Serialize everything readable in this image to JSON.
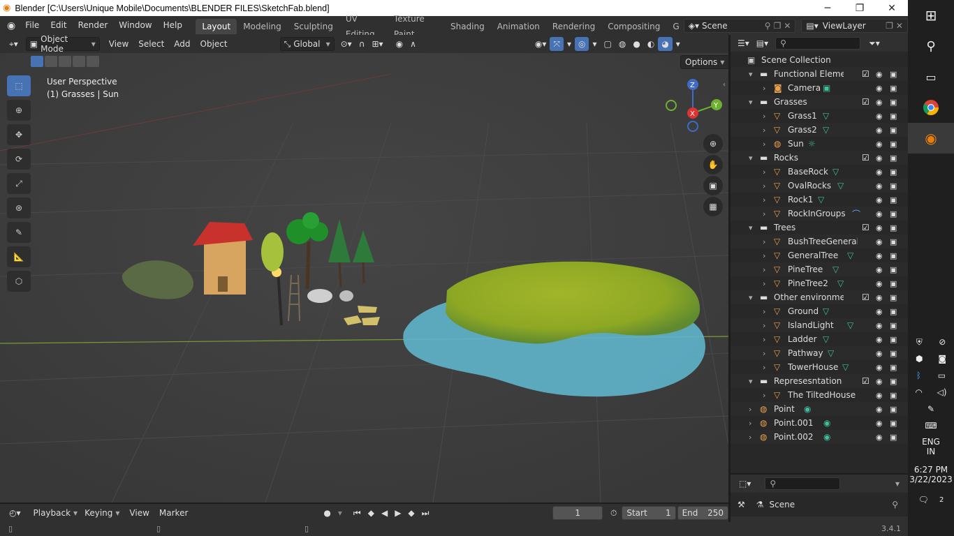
{
  "window": {
    "title": "Blender [C:\\Users\\Unique Mobile\\Documents\\BLENDER FILES\\SketchFab.blend]",
    "minimize": "─",
    "maximize": "❐",
    "close": "✕"
  },
  "menu": [
    "File",
    "Edit",
    "Render",
    "Window",
    "Help"
  ],
  "workspaces": [
    "Layout",
    "Modeling",
    "Sculpting",
    "UV Editing",
    "Texture Paint",
    "Shading",
    "Animation",
    "Rendering",
    "Compositing",
    "G"
  ],
  "scene_field": "Scene",
  "viewlayer_field": "ViewLayer",
  "viewport_header": {
    "mode": "Object Mode",
    "view": "View",
    "select": "Select",
    "add": "Add",
    "object": "Object",
    "orientation": "Global",
    "options": "Options"
  },
  "viewport": {
    "perspective": "User Perspective",
    "context": "(1) Grasses | Sun",
    "gizmo_x": "X",
    "gizmo_y": "Y",
    "gizmo_z": "Z"
  },
  "outliner": {
    "root": "Scene Collection",
    "rows": [
      {
        "name": "Functional Elements",
        "type": "collection",
        "level": 1,
        "check": true
      },
      {
        "name": "Camera",
        "type": "camera",
        "level": 2
      },
      {
        "name": "Grasses",
        "type": "collection",
        "level": 1,
        "check": true
      },
      {
        "name": "Grass1",
        "type": "mesh",
        "level": 2
      },
      {
        "name": "Grass2",
        "type": "mesh",
        "level": 2
      },
      {
        "name": "Sun",
        "type": "light",
        "level": 2
      },
      {
        "name": "Rocks",
        "type": "collection",
        "level": 1,
        "check": true
      },
      {
        "name": "BaseRock",
        "type": "mesh",
        "level": 2
      },
      {
        "name": "OvalRocks",
        "type": "mesh",
        "level": 2
      },
      {
        "name": "Rock1",
        "type": "mesh",
        "level": 2
      },
      {
        "name": "RockInGroups",
        "type": "curve",
        "level": 2
      },
      {
        "name": "Trees",
        "type": "collection",
        "level": 1,
        "check": true
      },
      {
        "name": "BushTreeGeneral",
        "type": "mesh-plain",
        "level": 2
      },
      {
        "name": "GeneralTree",
        "type": "mesh",
        "level": 2
      },
      {
        "name": "PineTree",
        "type": "mesh",
        "level": 2
      },
      {
        "name": "PineTree2",
        "type": "mesh",
        "level": 2
      },
      {
        "name": "Other environment",
        "type": "collection",
        "level": 1,
        "check": true
      },
      {
        "name": "Ground",
        "type": "mesh",
        "level": 2
      },
      {
        "name": "IslandLight",
        "type": "mesh",
        "level": 2
      },
      {
        "name": "Ladder",
        "type": "mesh",
        "level": 2
      },
      {
        "name": "Pathway",
        "type": "mesh",
        "level": 2
      },
      {
        "name": "TowerHouse",
        "type": "mesh",
        "level": 2
      },
      {
        "name": "Represesntation Scene",
        "type": "collection",
        "level": 1,
        "check": true
      },
      {
        "name": "The TiltedHouse isla",
        "type": "mesh-plain",
        "level": 2
      },
      {
        "name": "Point",
        "type": "point",
        "level": 1
      },
      {
        "name": "Point.001",
        "type": "point",
        "level": 1
      },
      {
        "name": "Point.002",
        "type": "point",
        "level": 1
      }
    ]
  },
  "properties": {
    "scene": "Scene"
  },
  "timeline": {
    "playback": "Playback",
    "keying": "Keying",
    "view": "View",
    "marker": "Marker",
    "current_frame": "1",
    "start_label": "Start",
    "start": "1",
    "end_label": "End",
    "end": "250"
  },
  "status": {
    "version": "3.4.1"
  },
  "taskbar": {
    "lang1": "ENG",
    "lang2": "IN",
    "time": "6:27 PM",
    "date": "3/22/2023",
    "notifications": "2"
  },
  "colors": {
    "accent": "#4772b3",
    "header": "#303030",
    "viewport": "#3d3d3d",
    "mesh_icon": "#3fbf9f",
    "collection_check": "#ffffff"
  }
}
